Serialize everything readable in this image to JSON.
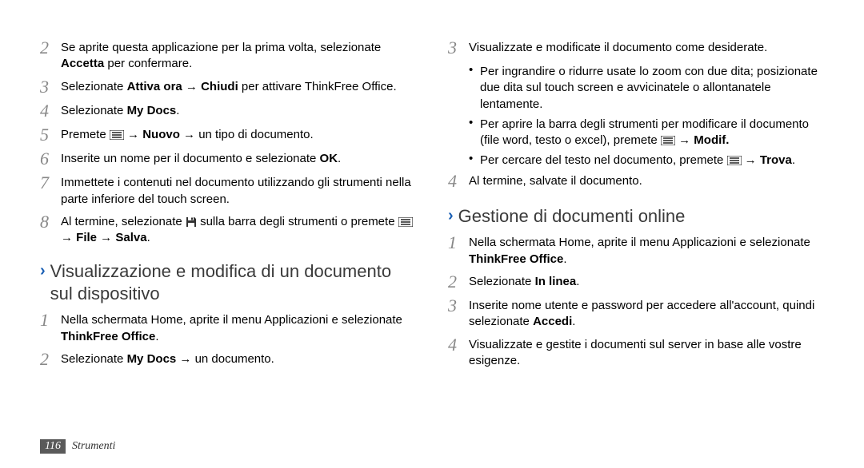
{
  "left": {
    "steps_a": [
      {
        "n": "2",
        "html": "Se aprite questa applicazione per la prima volta, selezionate <b>Accetta</b> per confermare."
      },
      {
        "n": "3",
        "html": "Selezionate <b>Attiva ora</b> → <b>Chiudi</b> per attivare ThinkFree Office."
      },
      {
        "n": "4",
        "html": "Selezionate <b>My Docs</b>."
      },
      {
        "n": "5",
        "html": "Premete [MENU] → <b>Nuovo</b> → un tipo di documento."
      },
      {
        "n": "6",
        "html": "Inserite un nome per il documento e selezionate <b>OK</b>."
      },
      {
        "n": "7",
        "html": "Immettete i contenuti nel documento utilizzando gli strumenti nella parte inferiore del touch screen."
      },
      {
        "n": "8",
        "html": "Al termine, selezionate [SAVE] sulla barra degli strumenti o premete [MENU] → <b>File</b> → <b>Salva</b>."
      }
    ],
    "subhead": "Visualizzazione e modifica di un documento sul dispositivo",
    "steps_b": [
      {
        "n": "1",
        "html": "Nella schermata Home, aprite il menu Applicazioni e selezionate <b>ThinkFree Office</b>."
      },
      {
        "n": "2",
        "html": "Selezionate <b>My Docs</b> → un documento."
      }
    ]
  },
  "right": {
    "first_step": {
      "n": "3",
      "html": "Visualizzate e modificate il documento come desiderate."
    },
    "bullets": [
      {
        "html": "Per ingrandire o ridurre usate lo zoom con due dita; posizionate due dita sul touch screen e avvicinatele o allontanatele lentamente."
      },
      {
        "html": "Per aprire la barra degli strumenti per modificare il documento (file word, testo o excel), premete [MENU] → <b>Modif.</b>"
      },
      {
        "html": "Per cercare del testo nel documento, premete [MENU] → <b>Trova</b>."
      }
    ],
    "after_step": {
      "n": "4",
      "html": "Al termine, salvate il documento."
    },
    "subhead": "Gestione di documenti online",
    "steps": [
      {
        "n": "1",
        "html": "Nella schermata Home, aprite il menu Applicazioni e selezionate <b>ThinkFree Office</b>."
      },
      {
        "n": "2",
        "html": "Selezionate <b>In linea</b>."
      },
      {
        "n": "3",
        "html": "Inserite nome utente e password per accedere all'account, quindi selezionate <b>Accedi</b>."
      },
      {
        "n": "4",
        "html": "Visualizzate e gestite i documenti sul server in base alle vostre esigenze."
      }
    ]
  },
  "footer": {
    "page": "116",
    "section": "Strumenti"
  }
}
